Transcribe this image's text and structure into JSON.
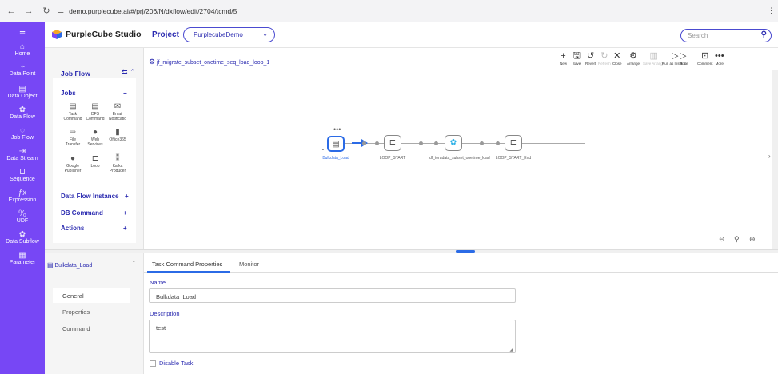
{
  "browser": {
    "url": "demo.purplecube.ai/#/prj/206/N/dxflow/edit/2704/tcmd/5"
  },
  "app": {
    "title": "PurpleCube Studio",
    "project_label": "Project",
    "project_value": "PurplecubeDemo",
    "search_placeholder": "Search"
  },
  "rail": {
    "items": [
      "Home",
      "Data Point",
      "Data Object",
      "Data Flow",
      "Job Flow",
      "Data Stream",
      "Sequence",
      "Expression",
      "UDF",
      "Data Subflow",
      "Parameter"
    ]
  },
  "jobflow_panel": {
    "title": "Job Flow",
    "jobs_label": "Jobs",
    "tools": [
      {
        "name": "task-command",
        "label1": "Task",
        "label2": "Command",
        "icon": "▤"
      },
      {
        "name": "dfs-command",
        "label1": "DFS",
        "label2": "Command",
        "icon": "▤"
      },
      {
        "name": "email-notification",
        "label1": "Email",
        "label2": "Notificatio",
        "icon": "✉"
      },
      {
        "name": "file-transfer",
        "label1": "File",
        "label2": "Transfer",
        "icon": "⇨"
      },
      {
        "name": "web-services",
        "label1": "Web",
        "label2": "Services",
        "icon": "●"
      },
      {
        "name": "office365",
        "label1": "Office365",
        "label2": "",
        "icon": "▮"
      },
      {
        "name": "google-publisher",
        "label1": "Google",
        "label2": "Publisher",
        "icon": "●"
      },
      {
        "name": "loop",
        "label1": "Loop",
        "label2": "",
        "icon": "⊏"
      },
      {
        "name": "kafka-producer",
        "label1": "Kafka",
        "label2": "Producer",
        "icon": "⁑"
      }
    ],
    "sections": [
      "Data Flow Instance",
      "DB Command",
      "Actions"
    ]
  },
  "canvas": {
    "flow_name": "jf_migrate_subset_onetime_seq_load_loop_1",
    "toolbar": [
      "New",
      "Save",
      "Revert",
      "Refresh",
      "Close",
      "Arrange",
      "Save Arrange",
      "Run as Instance",
      "Run",
      "Comment",
      "More"
    ],
    "nodes": [
      {
        "label": "Bulkdata_Load",
        "selected": true
      },
      {
        "label": "LOOP_START",
        "selected": false
      },
      {
        "label": "df_teradata_subset_onetime_load",
        "selected": false
      },
      {
        "label": "LOOP_START_End",
        "selected": false
      }
    ]
  },
  "bottom": {
    "task_name": "Bulkdata_Load",
    "nav": [
      "General",
      "Properties",
      "Command"
    ],
    "tabs": [
      "Task Command Properties",
      "Monitor"
    ],
    "name_label": "Name",
    "name_value": "Bulkdata_Load",
    "desc_label": "Description",
    "desc_value": "test",
    "disable_label": "Disable Task"
  },
  "colors": {
    "brand": "#7747f5",
    "accent": "#2b2bb0",
    "selection": "#2b6be6"
  }
}
